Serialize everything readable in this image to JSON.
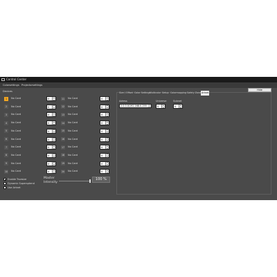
{
  "window": {
    "title": "Control Center"
  },
  "menu": {
    "items": [
      "Colorsettings",
      "Projectorsettings"
    ]
  },
  "devices": {
    "label": "Devices",
    "column1": [
      {
        "num": "1",
        "label": "No Card",
        "value": "0"
      },
      {
        "num": "2",
        "label": "No Card",
        "value": "0"
      },
      {
        "num": "3",
        "label": "No Card",
        "value": "0"
      },
      {
        "num": "4",
        "label": "No Card",
        "value": "0"
      },
      {
        "num": "5",
        "label": "No Card",
        "value": "0"
      },
      {
        "num": "6",
        "label": "No Card",
        "value": "0"
      },
      {
        "num": "7",
        "label": "No Card",
        "value": "0"
      },
      {
        "num": "8",
        "label": "No Card",
        "value": "0"
      },
      {
        "num": "9",
        "label": "No Card",
        "value": "0"
      },
      {
        "num": "10",
        "label": "No Card",
        "value": "0"
      }
    ],
    "column2": [
      {
        "num": "11",
        "label": "No Card",
        "value": "0"
      },
      {
        "num": "12",
        "label": "No Card",
        "value": "0"
      },
      {
        "num": "13",
        "label": "No Card",
        "value": "0"
      },
      {
        "num": "14",
        "label": "No Card",
        "value": "0"
      },
      {
        "num": "15",
        "label": "No Card",
        "value": "0"
      },
      {
        "num": "16",
        "label": "No Card",
        "value": "0"
      },
      {
        "num": "17",
        "label": "No Card",
        "value": "0"
      },
      {
        "num": "18",
        "label": "No Card",
        "value": "0"
      },
      {
        "num": "19",
        "label": "No Card",
        "value": "0"
      },
      {
        "num": "20",
        "label": "No Card",
        "value": "0"
      }
    ],
    "selected": "1"
  },
  "options": [
    {
      "label": "Enable Truesize",
      "checked": true
    },
    {
      "label": "Dynamic Supersptend",
      "checked": false
    },
    {
      "label": "Use Artnet",
      "checked": false
    }
  ],
  "master": {
    "label_line1": "Master",
    "label_line2": "Intensity",
    "value_text": "100 %",
    "level": 1.0
  },
  "tabs": {
    "items": [
      "Size / Offset",
      "Color Settings",
      "Multicolor",
      "Setup",
      "Colormapping",
      "Safety Zone",
      "Artnet"
    ],
    "active": "Artnet"
  },
  "artnet": {
    "hide_label": "Hide",
    "adress_label": "Adress",
    "adress_value": "2.0.0.0/192.168.0.255",
    "universe_label": "Universe",
    "universe_value": "0",
    "subnet_label": "Subnet",
    "subnet_value": "0"
  }
}
